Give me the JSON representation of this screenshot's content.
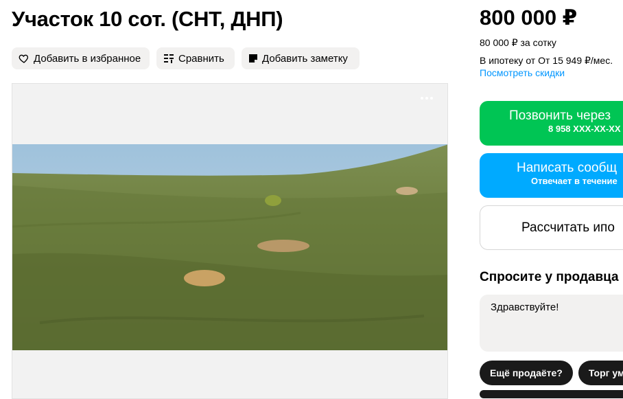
{
  "listing": {
    "title": "Участок 10 сот. (СНТ, ДНП)"
  },
  "actions": {
    "favorite_label": "Добавить в избранное",
    "compare_label": "Сравнить",
    "note_label": "Добавить заметку"
  },
  "price": {
    "total": "800 000 ₽",
    "per_sotka": "80 000 ₽ за сотку",
    "mortgage": "В ипотеку от От 15 949 ₽/мес.",
    "discounts_link": "Посмотреть скидки"
  },
  "contact": {
    "call_label": "Позвонить через",
    "call_phone": "8 958 ХХХ-ХХ-ХХ",
    "message_label": "Написать сообщ",
    "message_sub": "Отвечает в течение",
    "calc_label": "Рассчитать ипо"
  },
  "ask": {
    "title": "Спросите у продавца",
    "message": "Здравствуйте!",
    "chips": [
      "Ещё продаёте?",
      "Торг уместен?"
    ]
  },
  "colors": {
    "call": "#00c554",
    "message": "#00aaff",
    "link": "#0096ff"
  }
}
